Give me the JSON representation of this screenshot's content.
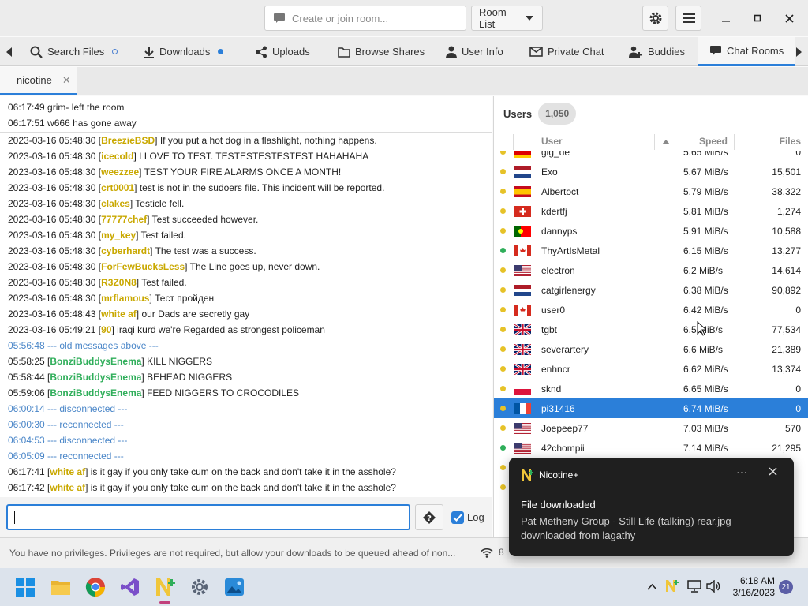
{
  "titlebar": {
    "room_placeholder": "Create or join room...",
    "room_list_label": "Room List"
  },
  "tabs": [
    {
      "label": "Search Files",
      "icon": "search-icon",
      "dot": "#4a7fd0"
    },
    {
      "label": "Downloads",
      "icon": "download-icon",
      "dot": "#2b7fd9"
    },
    {
      "label": "Uploads",
      "icon": "share-icon"
    },
    {
      "label": "Browse Shares",
      "icon": "folder-icon"
    },
    {
      "label": "User Info",
      "icon": "person-icon"
    },
    {
      "label": "Private Chat",
      "icon": "mail-icon"
    },
    {
      "label": "Buddies",
      "icon": "buddies-icon"
    },
    {
      "label": "Chat Rooms",
      "icon": "chat-icon"
    }
  ],
  "room_tab": {
    "label": "nicotine"
  },
  "activity": [
    "06:17:49 grim- left the room",
    "06:17:51 w666 has gone away"
  ],
  "chat": [
    {
      "time": "2023-03-16 05:48:30",
      "nick": "BreezieBSD",
      "color": "#c9a800",
      "text": " If you put a hot dog in a flashlight, nothing happens."
    },
    {
      "time": "2023-03-16 05:48:30",
      "nick": "icecold",
      "color": "#c9a800",
      "text": " I LOVE TO TEST. TESTESTESTESTEST HAHAHAHA"
    },
    {
      "time": "2023-03-16 05:48:30",
      "nick": "weezzee",
      "color": "#c9a800",
      "text": " TEST YOUR FIRE ALARMS ONCE A MONTH!"
    },
    {
      "time": "2023-03-16 05:48:30",
      "nick": "crt0001",
      "color": "#c9a800",
      "text": " test is not in the sudoers file. This incident will be reported."
    },
    {
      "time": "2023-03-16 05:48:30",
      "nick": "clakes",
      "color": "#c9a800",
      "text": " Testicle fell."
    },
    {
      "time": "2023-03-16 05:48:30",
      "nick": "77777chef",
      "color": "#c9a800",
      "text": " Test succeeded however."
    },
    {
      "time": "2023-03-16 05:48:30",
      "nick": "my_key",
      "color": "#c9a800",
      "text": " Test failed."
    },
    {
      "time": "2023-03-16 05:48:30",
      "nick": "cyberhardt",
      "color": "#c9a800",
      "text": " The test was a success."
    },
    {
      "time": "2023-03-16 05:48:30",
      "nick": "ForFewBucksLess",
      "color": "#c9a800",
      "text": " The Line goes up, never down."
    },
    {
      "time": "2023-03-16 05:48:30",
      "nick": "R3Z0N8",
      "color": "#c9a800",
      "text": " Test failed."
    },
    {
      "time": "2023-03-16 05:48:30",
      "nick": "mrflamous",
      "color": "#c9a800",
      "text": " Тест пройден"
    },
    {
      "time": "2023-03-16 05:48:43",
      "nick": "white af",
      "color": "#c9a800",
      "text": " our Dads are secretly gay"
    },
    {
      "time": "2023-03-16 05:49:21",
      "nick": "90",
      "color": "#c9a800",
      "text": " iraqi kurd we're Regarded as strongest policeman"
    },
    {
      "status": "05:56:48 --- old messages above ---"
    },
    {
      "time": "05:58:25",
      "nick": "BonziBuddysEnema",
      "color": "#2fae5a",
      "text": " KILL NIGGERS"
    },
    {
      "time": "05:58:44",
      "nick": "BonziBuddysEnema",
      "color": "#2fae5a",
      "text": " BEHEAD NIGGERS"
    },
    {
      "time": "05:59:06",
      "nick": "BonziBuddysEnema",
      "color": "#2fae5a",
      "text": " FEED NIGGERS TO CROCODILES"
    },
    {
      "status": "06:00:14 --- disconnected ---"
    },
    {
      "status": "06:00:30 --- reconnected ---"
    },
    {
      "status": "06:04:53 --- disconnected ---"
    },
    {
      "status": "06:05:09 --- reconnected ---"
    },
    {
      "time": "06:17:41",
      "nick": "white af",
      "color": "#c9a800",
      "text": " is it gay if you only take cum on the back and don't take it in the asshole?"
    },
    {
      "time": "06:17:42",
      "nick": "white af",
      "color": "#c9a800",
      "text": " is it gay if you only take cum on the back and don't take it in the asshole?"
    }
  ],
  "composer": {
    "log_label": "Log"
  },
  "users": {
    "title": "Users",
    "count": "1,050",
    "col_user": "User",
    "col_speed": "Speed",
    "col_files": "Files",
    "rows": [
      {
        "status": "#e6c228",
        "flag": "de",
        "name": "gig_de",
        "speed": "5.65 MiB/s",
        "files": "0"
      },
      {
        "status": "#e6c228",
        "flag": "nl",
        "name": "Exo",
        "speed": "5.67 MiB/s",
        "files": "15,501"
      },
      {
        "status": "#e6c228",
        "flag": "es",
        "name": "Albertoct",
        "speed": "5.79 MiB/s",
        "files": "38,322"
      },
      {
        "status": "#e6c228",
        "flag": "ch",
        "name": "kdertfj",
        "speed": "5.81 MiB/s",
        "files": "1,274"
      },
      {
        "status": "#e6c228",
        "flag": "pt",
        "name": "dannyps",
        "speed": "5.91 MiB/s",
        "files": "10,588"
      },
      {
        "status": "#2fae5a",
        "flag": "ca",
        "name": "ThyArtIsMetal",
        "speed": "6.15 MiB/s",
        "files": "13,277"
      },
      {
        "status": "#e6c228",
        "flag": "us",
        "name": "electron",
        "speed": "6.2 MiB/s",
        "files": "14,614"
      },
      {
        "status": "#e6c228",
        "flag": "nl",
        "name": "catgirlenergy",
        "speed": "6.38 MiB/s",
        "files": "90,892"
      },
      {
        "status": "#e6c228",
        "flag": "ca",
        "name": "user0",
        "speed": "6.42 MiB/s",
        "files": "0"
      },
      {
        "status": "#e6c228",
        "flag": "gb",
        "name": "tgbt",
        "speed": "6.5 MiB/s",
        "files": "77,534"
      },
      {
        "status": "#e6c228",
        "flag": "gb",
        "name": "severartery",
        "speed": "6.6 MiB/s",
        "files": "21,389"
      },
      {
        "status": "#e6c228",
        "flag": "gb",
        "name": "enhncr",
        "speed": "6.62 MiB/s",
        "files": "13,374"
      },
      {
        "status": "#e6c228",
        "flag": "pl",
        "name": "sknd",
        "speed": "6.65 MiB/s",
        "files": "0"
      },
      {
        "status": "#e6c228",
        "flag": "fr",
        "name": "pi31416",
        "speed": "6.74 MiB/s",
        "files": "0",
        "selected": true
      },
      {
        "status": "#e6c228",
        "flag": "us",
        "name": "Joepeep77",
        "speed": "7.03 MiB/s",
        "files": "570"
      },
      {
        "status": "#2fae5a",
        "flag": "us",
        "name": "42chompii",
        "speed": "7.14 MiB/s",
        "files": "21,295"
      },
      {
        "status": "#e6c228",
        "flag": "us",
        "name": "",
        "speed": "",
        "files": ""
      },
      {
        "status": "#e6c228",
        "flag": "us",
        "name": "",
        "speed": "",
        "files": ""
      }
    ]
  },
  "statusbar": {
    "text": "You have no privileges. Privileges are not required, but allow your downloads to be queued ahead of non...",
    "connections": "8"
  },
  "notification": {
    "app": "Nicotine+",
    "title": "File downloaded",
    "body": "Pat Metheny Group - Still Life (talking) rear.jpg downloaded from lagathy"
  },
  "taskbar": {
    "time": "6:18 AM",
    "date": "3/16/2023",
    "badge": "21"
  },
  "colors": {
    "accent": "#2b7fd9",
    "status_blue": "#4a86c8"
  }
}
